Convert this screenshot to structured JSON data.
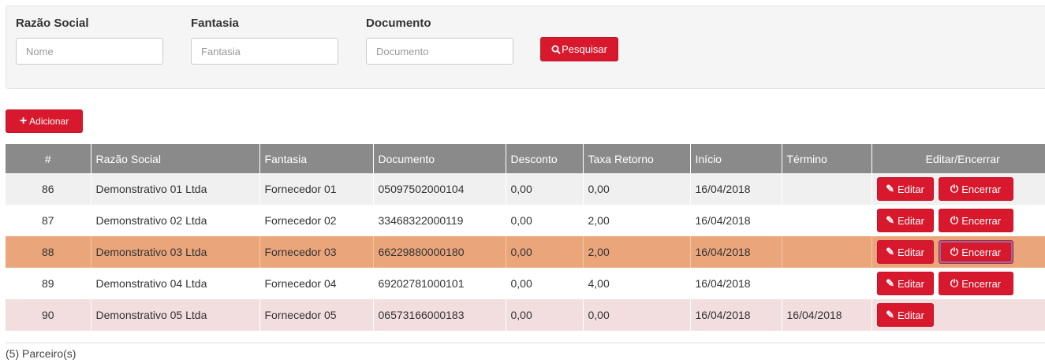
{
  "filters": {
    "razao_social": {
      "label": "Razão Social",
      "placeholder": "Nome"
    },
    "fantasia": {
      "label": "Fantasia",
      "placeholder": "Fantasia"
    },
    "documento": {
      "label": "Documento",
      "placeholder": "Documento"
    },
    "search_label": "Pesquisar",
    "search_icon": "search-icon"
  },
  "add_label": "Adicionar",
  "table": {
    "headers": [
      "#",
      "Razão Social",
      "Fantasia",
      "Documento",
      "Desconto",
      "Taxa Retorno",
      "Início",
      "Término",
      "Editar/Encerrar"
    ],
    "edit_label": "Editar",
    "close_label": "Encerrar",
    "rows": [
      {
        "id": "86",
        "razao": "Demonstrativo 01 Ltda",
        "fantasia": "Fornecedor 01",
        "documento": "05097502000104",
        "desconto": "0,00",
        "taxa": "0,00",
        "inicio": "16/04/2018",
        "termino": ""
      },
      {
        "id": "87",
        "razao": "Demonstrativo 02 Ltda",
        "fantasia": "Fornecedor 02",
        "documento": "33468322000119",
        "desconto": "0,00",
        "taxa": "2,00",
        "inicio": "16/04/2018",
        "termino": ""
      },
      {
        "id": "88",
        "razao": "Demonstrativo 03 Ltda",
        "fantasia": "Fornecedor 03",
        "documento": "66229880000180",
        "desconto": "0,00",
        "taxa": "2,00",
        "inicio": "16/04/2018",
        "termino": ""
      },
      {
        "id": "89",
        "razao": "Demonstrativo 04 Ltda",
        "fantasia": "Fornecedor 04",
        "documento": "69202781000101",
        "desconto": "0,00",
        "taxa": "4,00",
        "inicio": "16/04/2018",
        "termino": ""
      },
      {
        "id": "90",
        "razao": "Demonstrativo 05 Ltda",
        "fantasia": "Fornecedor 05",
        "documento": "06573166000183",
        "desconto": "0,00",
        "taxa": "0,00",
        "inicio": "16/04/2018",
        "termino": "16/04/2018"
      }
    ]
  },
  "footer": {
    "count_text": "(5) Parceiro(s)"
  },
  "colors": {
    "accent": "#d8182d",
    "header_bg": "#8a8a8a",
    "selected_row": "#eba57b",
    "closed_row": "#f2dede"
  }
}
